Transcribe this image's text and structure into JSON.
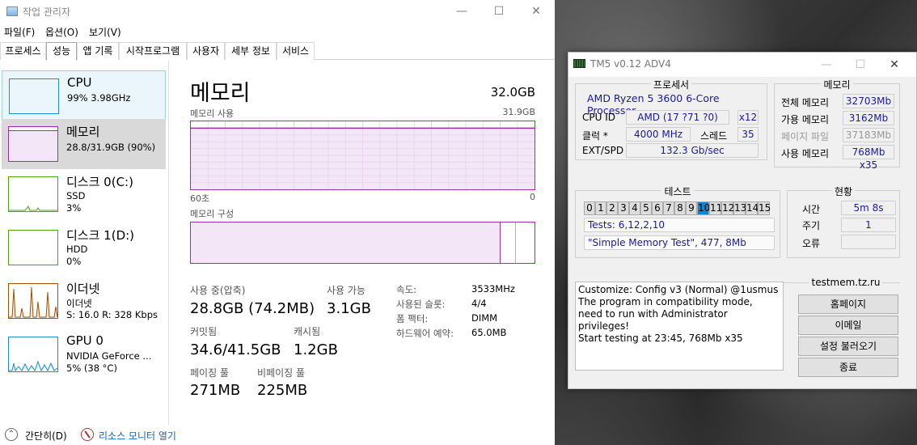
{
  "task_manager": {
    "title": "작업 관리자",
    "menu": [
      "파일(F)",
      "옵션(O)",
      "보기(V)"
    ],
    "tabs": [
      "프로세스",
      "성능",
      "앱 기록",
      "시작프로그램",
      "사용자",
      "세부 정보",
      "서비스"
    ],
    "active_tab": "성능",
    "sidebar": [
      {
        "name": "CPU",
        "sub1": "99% 3.98GHz"
      },
      {
        "name": "메모리",
        "sub1": "28.8/31.9GB (90%)"
      },
      {
        "name": "디스크 0(C:)",
        "sub1": "SSD",
        "sub2": "3%"
      },
      {
        "name": "디스크 1(D:)",
        "sub1": "HDD",
        "sub2": "0%"
      },
      {
        "name": "이더넷",
        "sub1": "이더넷",
        "sub2": "S: 16.0  R: 328 Kbps"
      },
      {
        "name": "GPU 0",
        "sub1": "NVIDIA GeForce ...",
        "sub2": "5% (38 °C)"
      }
    ],
    "memory": {
      "heading": "메모리",
      "total": "32.0GB",
      "usage_label": "메모리 사용",
      "usage_max": "31.9GB",
      "time_left": "60초",
      "time_right": "0",
      "composition_label": "메모리 구성",
      "in_use_label": "사용 중(압축)",
      "in_use_value": "28.8GB (74.2MB)",
      "available_label": "사용 가능",
      "available_value": "3.1GB",
      "committed_label": "커밋됨",
      "committed_value": "34.6/41.5GB",
      "cached_label": "캐시됨",
      "cached_value": "1.2GB",
      "paged_label": "페이징 풀",
      "paged_value": "271MB",
      "nonpaged_label": "비페이징 풀",
      "nonpaged_value": "225MB",
      "speed_label": "속도:",
      "speed_value": "3533MHz",
      "slots_label": "사용된 슬롯:",
      "slots_value": "4/4",
      "form_label": "폼 팩터:",
      "form_value": "DIMM",
      "reserved_label": "하드웨어 예약:",
      "reserved_value": "65.0MB",
      "usage_fraction": 0.9
    },
    "footer": {
      "less_label": "간단히(D)",
      "monitor_label": "리소스 모니터 열기"
    }
  },
  "tm5": {
    "title": "TM5 v0.12 ADV4",
    "processor_group": "프로세서",
    "cpu_name": "AMD Ryzen 5 3600 6-Core Processor",
    "cpu_id_label": "CPU ID",
    "cpu_id_value": "AMD  (17 ?71 ?0)",
    "cpu_id_mult": "x12",
    "clock_label": "클럭 *",
    "clock_value": "4000 MHz",
    "threads_label": "스레드",
    "threads_value": "35",
    "ext_label": "EXT/SPD",
    "ext_value": "132.3 Gb/sec",
    "memory_group": "메모리",
    "total_mem_label": "전체 메모리",
    "total_mem_value": "32703Mb",
    "avail_mem_label": "가용 메모리",
    "avail_mem_value": "3162Mb",
    "pagefile_label": "페이지 파일",
    "pagefile_value": "37183Mb",
    "used_mem_label": "사용 메모리",
    "used_mem_value": "768Mb x35",
    "test_group": "테스트",
    "test_numbers": [
      "0",
      "1",
      "2",
      "3",
      "4",
      "5",
      "6",
      "7",
      "8",
      "9",
      "10",
      "11",
      "12",
      "13",
      "14",
      "15"
    ],
    "active_test": "10",
    "tests_line": "Tests: 6,12,2,10",
    "config_line": "\"Simple Memory Test\", 477, 8Mb",
    "status_group": "현황",
    "time_label": "시간",
    "time_value": "5m 8s",
    "cycle_label": "주기",
    "cycle_value": "1",
    "error_label": "오류",
    "error_value": "",
    "site_group": "testmem.tz.ru",
    "log_lines": [
      "Customize: Config v3 (Normal) @1usmus",
      "The program in compatibility mode,",
      "need to run with Administrator privileges!",
      "Start testing at 23:45, 768Mb x35"
    ],
    "buttons": [
      "홈페이지",
      "이메일",
      "설정 불러오기",
      "종료"
    ]
  }
}
